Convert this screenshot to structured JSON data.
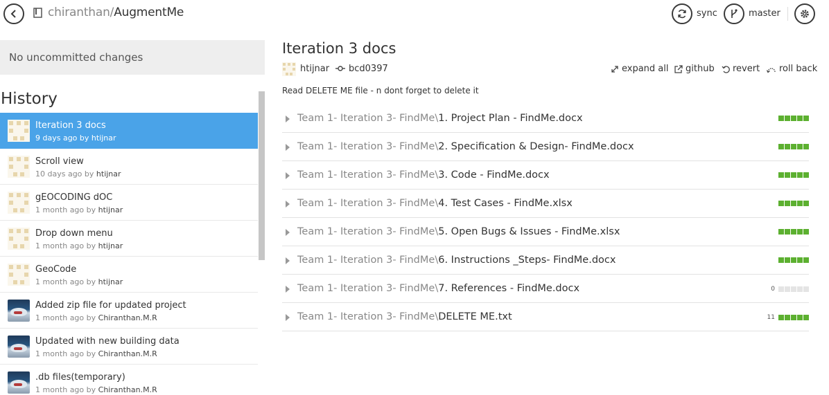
{
  "header": {
    "repo_owner": "chiranthan",
    "repo_separator": "/",
    "repo_name": "AugmentMe",
    "sync_label": "sync",
    "branch_label": "master"
  },
  "uncommitted": {
    "label": "No uncommitted changes"
  },
  "history": {
    "heading": "History",
    "items": [
      {
        "title": "Iteration 3 docs",
        "time": "9 days ago by",
        "author": "htijnar",
        "avatar": "identicon",
        "selected": true
      },
      {
        "title": "Scroll view",
        "time": "10 days ago by",
        "author": "htijnar",
        "avatar": "identicon",
        "selected": false
      },
      {
        "title": "gEOCODING dOC",
        "time": "1 month ago by",
        "author": "htijnar",
        "avatar": "identicon",
        "selected": false
      },
      {
        "title": "Drop down menu",
        "time": "1 month ago by",
        "author": "htijnar",
        "avatar": "identicon",
        "selected": false
      },
      {
        "title": "GeoCode",
        "time": "1 month ago by",
        "author": "htijnar",
        "avatar": "identicon",
        "selected": false
      },
      {
        "title": "Added zip file for updated project",
        "time": "1 month ago by",
        "author": "Chiranthan.M.R",
        "avatar": "photo",
        "selected": false
      },
      {
        "title": "Updated with new building data",
        "time": "1 month ago by",
        "author": "Chiranthan.M.R",
        "avatar": "photo",
        "selected": false
      },
      {
        "title": ".db files(temporary)",
        "time": "1 month ago by",
        "author": "Chiranthan.M.R",
        "avatar": "photo",
        "selected": false
      }
    ]
  },
  "commit": {
    "title": "Iteration 3 docs",
    "author": "htijnar",
    "sha": "bcd0397",
    "message": "Read DELETE ME file - n dont forget to delete it",
    "actions": {
      "expand_all": "expand all",
      "github": "github",
      "revert": "revert",
      "roll_back": "roll back"
    }
  },
  "files": [
    {
      "dir": "Team 1- Iteration 3- FindMe\\",
      "name": "1. Project Plan - FindMe.docx",
      "count": "",
      "filled": 5
    },
    {
      "dir": "Team 1- Iteration 3- FindMe\\",
      "name": "2. Specification & Design- FindMe.docx",
      "count": "",
      "filled": 5
    },
    {
      "dir": "Team 1- Iteration 3- FindMe\\",
      "name": "3. Code - FindMe.docx",
      "count": "",
      "filled": 5
    },
    {
      "dir": "Team 1- Iteration 3- FindMe\\",
      "name": "4. Test Cases - FindMe.xlsx",
      "count": "",
      "filled": 5
    },
    {
      "dir": "Team 1- Iteration 3- FindMe\\",
      "name": "5. Open Bugs & Issues - FindMe.xlsx",
      "count": "",
      "filled": 5
    },
    {
      "dir": "Team 1- Iteration 3- FindMe\\",
      "name": "6. Instructions _Steps- FindMe.docx",
      "count": "",
      "filled": 5
    },
    {
      "dir": "Team 1- Iteration 3- FindMe\\",
      "name": "7. References - FindMe.docx",
      "count": "0",
      "filled": 0
    },
    {
      "dir": "Team 1- Iteration 3- FindMe\\",
      "name": "DELETE ME.txt",
      "count": "11",
      "filled": 5
    }
  ],
  "colors": {
    "selected_bg": "#4aa3e8",
    "diff_added": "#5cb030",
    "diff_empty": "#e4e4e4"
  }
}
